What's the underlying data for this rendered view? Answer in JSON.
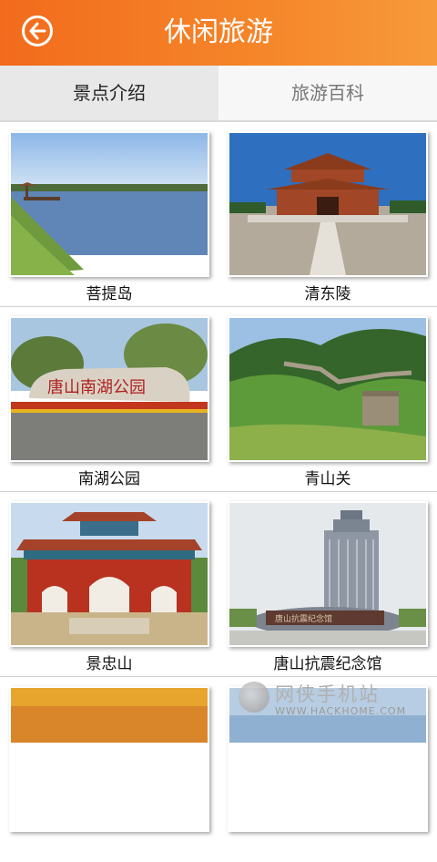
{
  "header": {
    "title": "休闲旅游",
    "back_icon": "back-arrow-icon"
  },
  "tabs": [
    {
      "label": "景点介绍",
      "active": true
    },
    {
      "label": "旅游百科",
      "active": false
    }
  ],
  "attractions": [
    {
      "name": "菩提岛"
    },
    {
      "name": "清东陵"
    },
    {
      "name": "南湖公园"
    },
    {
      "name": "青山关"
    },
    {
      "name": "景忠山"
    },
    {
      "name": "唐山抗震纪念馆"
    }
  ],
  "watermark": {
    "text": "网侠手机站",
    "url": "WWW.HACKHOME.COM"
  }
}
